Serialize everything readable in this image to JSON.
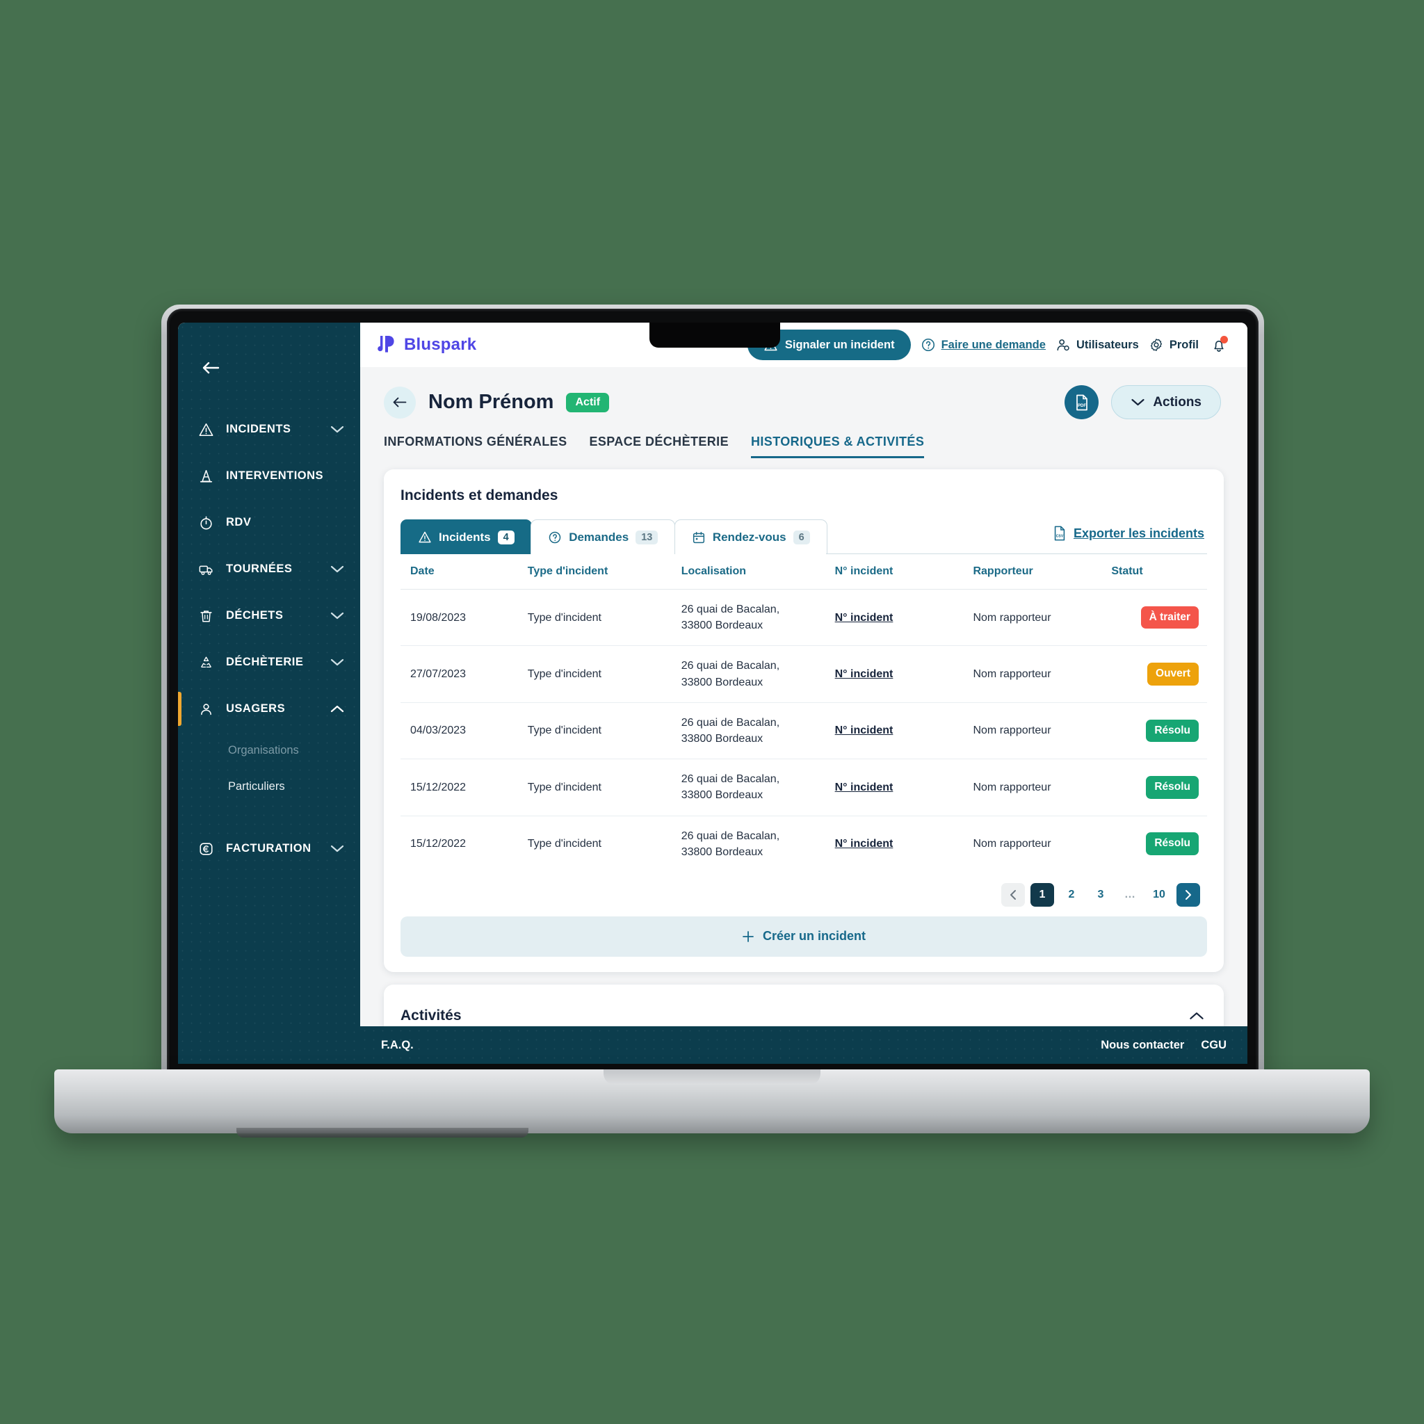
{
  "brand": {
    "name": "Bluspark",
    "color": "#4f46e5",
    "logo_icon": "bluspark-logo-icon"
  },
  "topbar": {
    "report_incident_label": "Signaler un incident",
    "report_incident_icon": "warning-triangle-icon",
    "make_request_label": "Faire une demande",
    "make_request_icon": "question-circle-icon",
    "users_label": "Utilisateurs",
    "users_icon": "user-gear-icon",
    "profile_label": "Profil",
    "profile_icon": "gear-icon",
    "bell_icon": "notification-bell-icon",
    "accent_color": "#166b86"
  },
  "sidebar": {
    "collapse_icon": "arrow-left-icon",
    "background_color": "#0c3d4d",
    "active_marker_color": "#f0a830",
    "items": [
      {
        "label": "INCIDENTS",
        "icon": "warning-triangle-icon",
        "chevron": "chevron-down-icon",
        "active": false
      },
      {
        "label": "INTERVENTIONS",
        "icon": "traffic-cone-icon",
        "chevron": "",
        "active": false
      },
      {
        "label": "RDV",
        "icon": "stopwatch-icon",
        "chevron": "",
        "active": false
      },
      {
        "label": "TOURNÉES",
        "icon": "truck-icon",
        "chevron": "chevron-down-icon",
        "active": false
      },
      {
        "label": "DÉCHETS",
        "icon": "trash-icon",
        "chevron": "chevron-down-icon",
        "active": false
      },
      {
        "label": "DÉCHÈTERIE",
        "icon": "recycle-icon",
        "chevron": "chevron-down-icon",
        "active": false
      },
      {
        "label": "USAGERS",
        "icon": "user-icon",
        "chevron": "chevron-up-icon",
        "active": true
      },
      {
        "label": "FACTURATION",
        "icon": "euro-circle-icon",
        "chevron": "chevron-down-icon",
        "active": false
      }
    ],
    "usagers_children": [
      {
        "label": "Organisations",
        "dimmed": true
      },
      {
        "label": "Particuliers",
        "dimmed": false
      }
    ]
  },
  "page_header": {
    "back_icon": "arrow-left-icon",
    "title": "Nom Prénom",
    "status_badge": "Actif",
    "status_badge_color": "#22b573",
    "pdf_button_icon": "pdf-file-icon",
    "actions_label": "Actions",
    "actions_chevron": "chevron-down-icon"
  },
  "page_tabs": [
    {
      "label": "INFORMATIONS GÉNÉRALES",
      "active": false
    },
    {
      "label": "ESPACE DÉCHÈTERIE",
      "active": false
    },
    {
      "label": "HISTORIQUES & ACTIVITÉS",
      "active": true
    }
  ],
  "incidents_card": {
    "title": "Incidents et demandes",
    "export_label": "Exporter les incidents",
    "export_icon": "csv-file-icon",
    "inner_tabs": [
      {
        "label": "Incidents",
        "count": "4",
        "icon": "warning-triangle-icon",
        "active": true
      },
      {
        "label": "Demandes",
        "count": "13",
        "icon": "question-circle-icon",
        "active": false
      },
      {
        "label": "Rendez-vous",
        "count": "6",
        "icon": "calendar-icon",
        "active": false
      }
    ],
    "columns": [
      "Date",
      "Type d'incident",
      "Localisation",
      "N° incident",
      "Rapporteur",
      "Statut"
    ],
    "rows": [
      {
        "date": "19/08/2023",
        "type": "Type d'incident",
        "location_line1": "26 quai de Bacalan,",
        "location_line2": "33800 Bordeaux",
        "number": "N° incident",
        "reporter": "Nom rapporteur",
        "status": "À traiter",
        "status_color": "#f4554a"
      },
      {
        "date": "27/07/2023",
        "type": "Type d'incident",
        "location_line1": "26 quai de Bacalan,",
        "location_line2": "33800 Bordeaux",
        "number": "N° incident",
        "reporter": "Nom rapporteur",
        "status": "Ouvert",
        "status_color": "#eda20c"
      },
      {
        "date": "04/03/2023",
        "type": "Type d'incident",
        "location_line1": "26 quai de Bacalan,",
        "location_line2": "33800 Bordeaux",
        "number": "N° incident",
        "reporter": "Nom rapporteur",
        "status": "Résolu",
        "status_color": "#17a673"
      },
      {
        "date": "15/12/2022",
        "type": "Type d'incident",
        "location_line1": "26 quai de Bacalan,",
        "location_line2": "33800 Bordeaux",
        "number": "N° incident",
        "reporter": "Nom rapporteur",
        "status": "Résolu",
        "status_color": "#17a673"
      },
      {
        "date": "15/12/2022",
        "type": "Type d'incident",
        "location_line1": "26 quai de Bacalan,",
        "location_line2": "33800 Bordeaux",
        "number": "N° incident",
        "reporter": "Nom rapporteur",
        "status": "Résolu",
        "status_color": "#17a673"
      }
    ],
    "pagination": {
      "prev_icon": "chevron-left-icon",
      "next_icon": "chevron-right-icon",
      "pages": [
        "1",
        "2",
        "3",
        "…",
        "10"
      ],
      "current_page": "1"
    },
    "create_label": "Créer un incident",
    "create_icon": "plus-icon"
  },
  "activities_card": {
    "title": "Activités",
    "toggle_icon": "chevron-up-icon"
  },
  "footer": {
    "faq_label": "F.A.Q.",
    "contact_label": "Nous contacter",
    "cgu_label": "CGU"
  }
}
